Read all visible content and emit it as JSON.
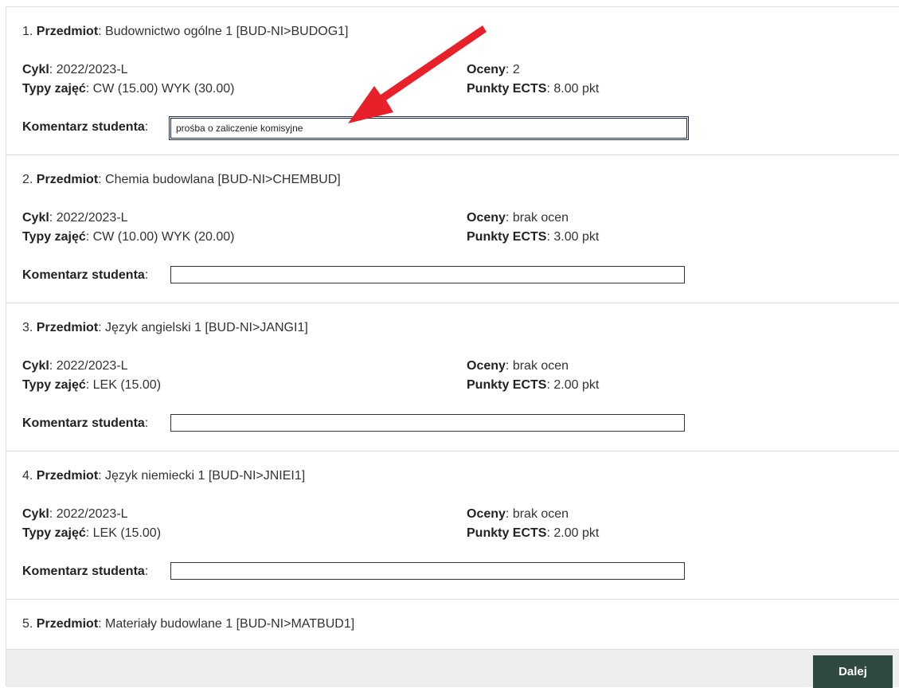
{
  "labels": {
    "subject": "Przedmiot",
    "cycle": "Cykl",
    "class_types": "Typy zajęć",
    "grades": "Oceny",
    "ects": "Punkty ECTS",
    "comment": "Komentarz studenta"
  },
  "courses": [
    {
      "num": "1.",
      "name": "Budownictwo ogólne 1 [BUD-NI>BUDOG1]",
      "cycle": "2022/2023-L",
      "class_types": "CW (15.00) WYK (30.00)",
      "grades": "2",
      "ects": "8.00 pkt",
      "comment": "prośba o zaliczenie komisyjne"
    },
    {
      "num": "2.",
      "name": "Chemia budowlana [BUD-NI>CHEMBUD]",
      "cycle": "2022/2023-L",
      "class_types": "CW (10.00) WYK (20.00)",
      "grades": "brak ocen",
      "ects": "3.00 pkt",
      "comment": ""
    },
    {
      "num": "3.",
      "name": "Język angielski 1 [BUD-NI>JANGI1]",
      "cycle": "2022/2023-L",
      "class_types": "LEK (15.00)",
      "grades": "brak ocen",
      "ects": "2.00 pkt",
      "comment": ""
    },
    {
      "num": "4.",
      "name": "Język niemiecki 1 [BUD-NI>JNIEI1]",
      "cycle": "2022/2023-L",
      "class_types": "LEK (15.00)",
      "grades": "brak ocen",
      "ects": "2.00 pkt",
      "comment": ""
    },
    {
      "num": "5.",
      "name": "Materiały budowlane 1 [BUD-NI>MATBUD1]"
    }
  ],
  "footer": {
    "next_label": "Dalej"
  },
  "colors": {
    "annotation_arrow": "#e8202a",
    "button_bg": "#2e4a42"
  }
}
